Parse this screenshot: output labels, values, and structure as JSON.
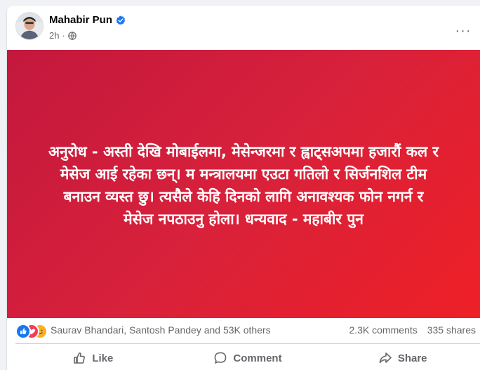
{
  "post": {
    "author_name": "Mahabir Pun",
    "time": "2h",
    "more_label": "···",
    "verified_icon": "verified-badge-icon",
    "privacy_icon": "globe-icon",
    "body_text": "अनुरोध - अस्ती देखि मोबाईलमा, मेसेन्जरमा र ह्वाट्सअपमा हजारौं कल र मेसेज आई रहेका छन्। म मन्त्रालयमा एउटा गतिलो र सिर्जनशिल टीम बनाउन व्यस्त छु। त्यसैले केहि दिनको लागि अनावश्यक फोन नगर्न र मेसेज नपठाउनु होला। धन्यवाद - महाबीर पुन",
    "banner_colors": [
      "#c3183d",
      "#ee2026"
    ]
  },
  "engagement": {
    "reactors": "Saurav Bhandari, Santosh Pandey and 53K others",
    "comments": "2.3K comments",
    "shares": "335 shares",
    "reaction_icons": [
      "like-reaction-icon",
      "love-reaction-icon",
      "care-reaction-icon"
    ]
  },
  "actions": {
    "like_label": "Like",
    "comment_label": "Comment",
    "share_label": "Share"
  },
  "colors": {
    "brand_blue": "#1877f2",
    "muted_text": "#65676b"
  }
}
